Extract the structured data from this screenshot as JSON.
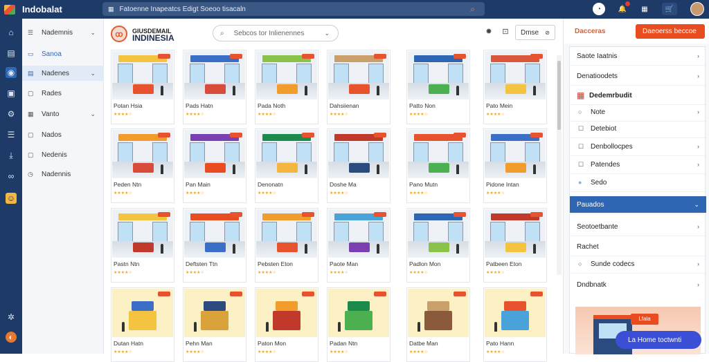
{
  "app": {
    "brand": "Indobalat"
  },
  "topbar": {
    "search_text": "Fatoenne Inapeatcs Edigt   Soeoo   tisacaln",
    "icons": [
      "grid-icon",
      "search-icon",
      "time-icon",
      "bell-icon",
      "apps-icon",
      "shop-icon",
      "avatar"
    ]
  },
  "nav": {
    "items": [
      {
        "label": "Nademnis",
        "icon": "menu-icon",
        "chevron": true
      },
      {
        "label": "Sanoa",
        "icon": "tag-icon",
        "chevron": false
      },
      {
        "label": "Nadenes",
        "icon": "list-icon",
        "chevron": true
      },
      {
        "label": "Rades",
        "icon": "doc-icon",
        "chevron": false
      },
      {
        "label": "Vanto",
        "icon": "grid-icon",
        "chevron": true
      },
      {
        "label": "Nados",
        "icon": "doc-icon",
        "chevron": false
      },
      {
        "label": "Nedenis",
        "icon": "doc-icon",
        "chevron": false
      },
      {
        "label": "Nadennis",
        "icon": "clock-icon",
        "chevron": false
      }
    ]
  },
  "main": {
    "title_line1": "GIUSDEMAIL",
    "title_line2": "INDINESIA",
    "search_placeholder": "Sebcos tor Inlienennes",
    "dm_label": "Dmse",
    "cards": [
      {
        "name": "Potan Hsia",
        "rating": 4
      },
      {
        "name": "Pads Hatn",
        "rating": 4
      },
      {
        "name": "Pada Noth",
        "rating": 4
      },
      {
        "name": "Dahsiienan",
        "rating": 4
      },
      {
        "name": "Patto Non",
        "rating": 4
      },
      {
        "name": "Pato Mein",
        "rating": 4
      },
      {
        "name": "Peden Ntn",
        "rating": 4
      },
      {
        "name": "Pan Main",
        "rating": 4
      },
      {
        "name": "Denonatn",
        "rating": 4
      },
      {
        "name": "Doshe Ma",
        "rating": 4
      },
      {
        "name": "Pano Mutn",
        "rating": 4
      },
      {
        "name": "Pidone Intan",
        "rating": 4
      },
      {
        "name": "Pastn Ntn",
        "rating": 4
      },
      {
        "name": "Deftsten Ttn",
        "rating": 4
      },
      {
        "name": "Pebsten Eton",
        "rating": 4
      },
      {
        "name": "Paote Man",
        "rating": 4
      },
      {
        "name": "Padlon Mon",
        "rating": 4
      },
      {
        "name": "Patbeen Eton",
        "rating": 4
      },
      {
        "name": "Dutan Hatn",
        "rating": 4
      },
      {
        "name": "Pehn Man",
        "rating": 4
      },
      {
        "name": "Paton Mon",
        "rating": 4
      },
      {
        "name": "Padan Ntn",
        "rating": 4
      },
      {
        "name": "Datbe Man",
        "rating": 4
      },
      {
        "name": "Pato Hann",
        "rating": 4
      }
    ]
  },
  "right": {
    "head_label": "Dacceras",
    "cta_label": "Daeoerss beccoe",
    "rows": [
      {
        "label": "Saote Iaatnis",
        "chevron": true,
        "type": "row"
      },
      {
        "label": "Denatioodets",
        "chevron": true,
        "type": "row"
      },
      {
        "label": "Dedemrbudit",
        "chevron": false,
        "type": "brand"
      },
      {
        "label": "Note",
        "chevron": true,
        "type": "radio"
      },
      {
        "label": "Detebiot",
        "chevron": false,
        "type": "check"
      },
      {
        "label": "Denbollocpes",
        "chevron": true,
        "type": "check"
      },
      {
        "label": "Patendes",
        "chevron": true,
        "type": "check"
      },
      {
        "label": "Sedo",
        "chevron": false,
        "type": "dot"
      },
      {
        "label": "Pauados",
        "chevron": true,
        "type": "selected"
      },
      {
        "label": "Seotoetbante",
        "chevron": true,
        "type": "row"
      },
      {
        "label": "Rachet",
        "chevron": false,
        "type": "row"
      },
      {
        "label": "Sunde codecs",
        "chevron": true,
        "type": "radio"
      },
      {
        "label": "Dndbnatk",
        "chevron": true,
        "type": "row"
      }
    ],
    "promo_sign": "Lfala"
  },
  "chat": {
    "label": "La Home toctwnti"
  },
  "colors": {
    "accent": "#e94c1f",
    "nav_dark": "#1e3a66",
    "selected_blue": "#2f66b3"
  }
}
